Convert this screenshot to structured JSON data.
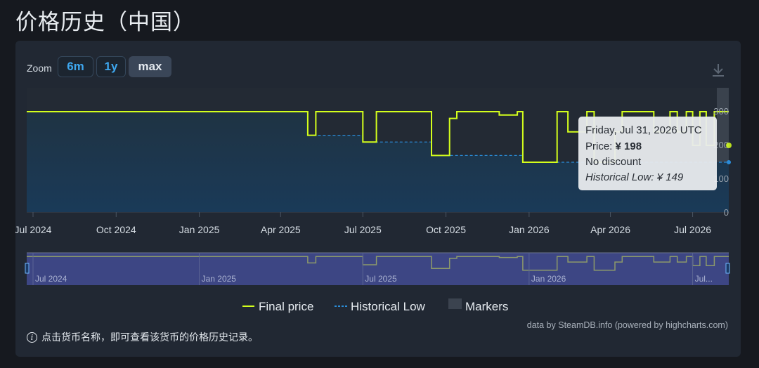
{
  "page": {
    "title": "价格历史（中国）"
  },
  "zoom": {
    "label": "Zoom",
    "buttons": [
      "6m",
      "1y",
      "max"
    ],
    "active": "max"
  },
  "colors": {
    "final_price": "#d4ff1c",
    "historical_low": "#2b8cd8",
    "markers": "#3b434f",
    "tooltip_bg": "#e9ebee",
    "navigator_bg": "#3d4684"
  },
  "icons": {
    "download": "download-icon",
    "info": "info-icon"
  },
  "chart_data": {
    "type": "line",
    "currency": "¥",
    "x_ticks": [
      "Jul 2024",
      "Oct 2024",
      "Jan 2025",
      "Apr 2025",
      "Jul 2025",
      "Oct 2025",
      "Jan 2026",
      "Apr 2026",
      "Jul 2026"
    ],
    "x_tick_dates": [
      "2024-07-01",
      "2024-10-01",
      "2025-01-01",
      "2025-04-01",
      "2025-07-01",
      "2025-10-01",
      "2026-01-01",
      "2026-04-01",
      "2026-07-01"
    ],
    "y_ticks": [
      "300",
      "200",
      "100",
      "0"
    ],
    "y_tick_values": [
      300,
      200,
      100,
      0
    ],
    "xlim": [
      "2024-06-24",
      "2026-08-10"
    ],
    "ylim": [
      0,
      300
    ],
    "series": [
      {
        "name": "Final price",
        "style": "step",
        "points": [
          [
            "2024-06-24",
            298
          ],
          [
            "2025-05-01",
            228
          ],
          [
            "2025-05-10",
            298
          ],
          [
            "2025-07-01",
            208
          ],
          [
            "2025-07-16",
            298
          ],
          [
            "2025-09-15",
            168
          ],
          [
            "2025-10-05",
            278
          ],
          [
            "2025-10-13",
            298
          ],
          [
            "2025-11-29",
            288
          ],
          [
            "2025-12-19",
            298
          ],
          [
            "2025-12-25",
            148
          ],
          [
            "2026-02-01",
            298
          ],
          [
            "2026-02-13",
            238
          ],
          [
            "2026-03-06",
            298
          ],
          [
            "2026-03-14",
            148
          ],
          [
            "2026-04-06",
            238
          ],
          [
            "2026-04-14",
            298
          ],
          [
            "2026-05-19",
            238
          ],
          [
            "2026-06-06",
            298
          ],
          [
            "2026-06-14",
            238
          ],
          [
            "2026-06-24",
            298
          ],
          [
            "2026-07-01",
            198
          ],
          [
            "2026-07-09",
            298
          ],
          [
            "2026-07-16",
            198
          ],
          [
            "2026-07-25",
            298
          ],
          [
            "2026-08-10",
            298
          ]
        ]
      },
      {
        "name": "Historical Low",
        "style": "step-dashed",
        "points": [
          [
            "2024-06-24",
            298
          ],
          [
            "2025-05-01",
            228
          ],
          [
            "2025-07-01",
            208
          ],
          [
            "2025-09-15",
            168
          ],
          [
            "2025-12-25",
            148
          ],
          [
            "2026-08-10",
            148
          ]
        ]
      },
      {
        "name": "Markers",
        "style": "marker"
      }
    ],
    "navigator": {
      "x_ticks": [
        "Jul 2024",
        "Jan 2025",
        "Jul 2025",
        "Jan 2026",
        "Jul..."
      ]
    },
    "tooltip": {
      "date": "Friday, Jul 31, 2026 UTC",
      "price_label": "Price: ",
      "price_value": "¥ 198",
      "discount": "No discount",
      "historical_low": "Historical Low: ¥ 149"
    },
    "credits": "data by SteamDB.info (powered by highcharts.com)"
  },
  "footer": {
    "note": "点击货币名称，即可查看该货币的价格历史记录。"
  }
}
